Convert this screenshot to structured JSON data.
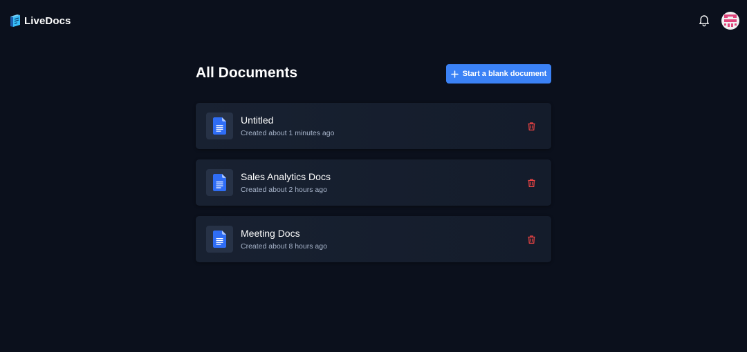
{
  "header": {
    "brand_name": "LiveDocs",
    "logo_icon": "livedocs-logo-icon",
    "notifications_icon": "bell-icon",
    "avatar_icon": "user-avatar"
  },
  "main": {
    "title": "All Documents",
    "new_document_button": {
      "label": "Start a blank document",
      "icon": "plus-icon"
    },
    "documents": [
      {
        "title": "Untitled",
        "created": "Created about 1 minutes ago",
        "icon": "document-icon",
        "delete_icon": "trash-icon"
      },
      {
        "title": "Sales Analytics Docs",
        "created": "Created about 2 hours ago",
        "icon": "document-icon",
        "delete_icon": "trash-icon"
      },
      {
        "title": "Meeting Docs",
        "created": "Created about 8 hours ago",
        "icon": "document-icon",
        "delete_icon": "trash-icon"
      }
    ]
  },
  "colors": {
    "background": "#0b101c",
    "card": "#182131",
    "accent": "#3b82f6",
    "danger": "#ef4444",
    "muted_text": "#a8b5cb"
  }
}
